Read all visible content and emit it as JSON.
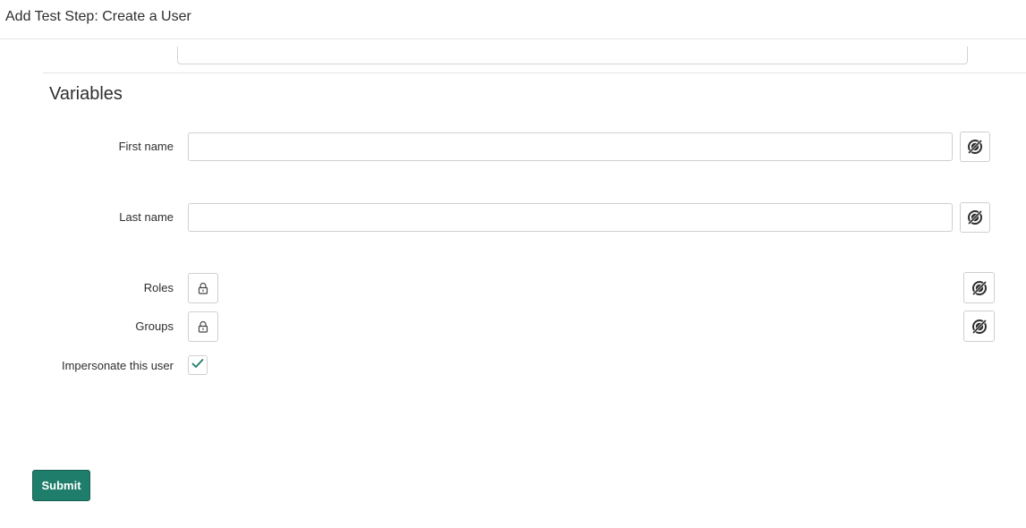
{
  "header": {
    "title": "Add Test Step: Create a User"
  },
  "section": {
    "title": "Variables"
  },
  "fields": {
    "first_name": {
      "label": "First name",
      "value": "",
      "icon": "data-pill-picker-icon"
    },
    "last_name": {
      "label": "Last name",
      "value": "",
      "icon": "data-pill-picker-icon"
    },
    "roles": {
      "label": "Roles",
      "icon": "lock-icon",
      "picker_icon": "data-pill-picker-icon"
    },
    "groups": {
      "label": "Groups",
      "icon": "lock-icon",
      "picker_icon": "data-pill-picker-icon"
    },
    "impersonate": {
      "label": "Impersonate this user",
      "checked": true
    }
  },
  "actions": {
    "submit_label": "Submit"
  },
  "colors": {
    "submit_bg": "#1f7d6b",
    "checkmark": "#1f7d6b"
  }
}
